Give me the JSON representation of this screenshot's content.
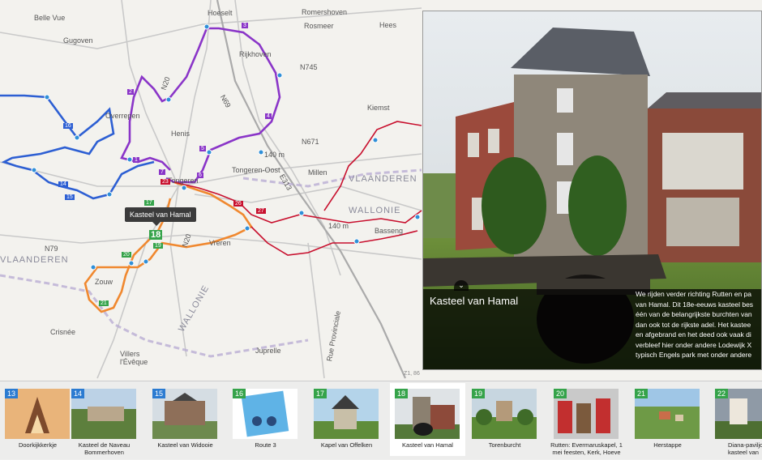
{
  "map": {
    "places": [
      "Belle Vue",
      "Hoeselt",
      "Gugoven",
      "Romershoven",
      "Rosmeer",
      "Hees",
      "Rijkhoven",
      "Overrepen",
      "Henis",
      "Kiemst",
      "Tongeren-Oost",
      "Millen",
      "VLAANDEREN",
      "WALLONIE",
      "Basseng",
      "Vreren",
      "Zouw",
      "Crisnée",
      "Villers l'Évêque",
      "Juprelle",
      "Rue Provinciale",
      "VLAANDEREN",
      "WALLONIE",
      "Tongeren"
    ],
    "road_labels": [
      "N745",
      "N20",
      "N79",
      "N20",
      "N69",
      "E313",
      "N671"
    ],
    "elevation_labels": [
      "140 m",
      "140 m"
    ],
    "tooltip": "Kasteel van Hamal",
    "markers": [
      "1",
      "2",
      "3",
      "4",
      "5",
      "6",
      "7",
      "14",
      "15",
      "16",
      "17",
      "18",
      "19",
      "20",
      "21",
      "23",
      "26",
      "27"
    ]
  },
  "detail": {
    "title": "Kasteel van Hamal",
    "text_lines": [
      "We rijden verder richting Rutten en pa",
      "van Hamal. Dit 18e-eeuws kasteel bes",
      "één van de belangrijkste burchten van",
      "dan ook tot de rijkste adel. Het kastee",
      "en afgebrand en het deed ook vaak di",
      "verbleef hier onder andere Lodewijk X",
      "typisch Engels park met onder andere"
    ],
    "collapse_icon": "chevron-down-icon"
  },
  "strip": [
    {
      "num": "13",
      "label": "Doorkijkkerkje",
      "color": "blue"
    },
    {
      "num": "14",
      "label": "Kasteel de Naveau Bommerhoven",
      "color": "blue"
    },
    {
      "num": "15",
      "label": "Kasteel van Widooie",
      "color": "blue"
    },
    {
      "num": "16",
      "label": "Route 3",
      "color": "green"
    },
    {
      "num": "17",
      "label": "Kapel van Offelken",
      "color": "green"
    },
    {
      "num": "18",
      "label": "Kasteel van Hamal",
      "color": "green"
    },
    {
      "num": "19",
      "label": "Torenburcht",
      "color": "green"
    },
    {
      "num": "20",
      "label": "Rutten: Evermaruskapel, 1 mei feesten, Kerk, Hoeve",
      "color": "green"
    },
    {
      "num": "21",
      "label": "Herstappe",
      "color": "green"
    },
    {
      "num": "22",
      "label": "Diana-paviljoe kasteel van",
      "color": "green"
    }
  ],
  "strip_partial_label": "Z1, 86",
  "colors": {
    "blue_route": "#2d5fd3",
    "purple_route": "#8a35c8",
    "orange_route": "#f0882f",
    "red_route": "#c8102e",
    "strip_blue": "#2b7bd1",
    "strip_green": "#35a34a"
  }
}
